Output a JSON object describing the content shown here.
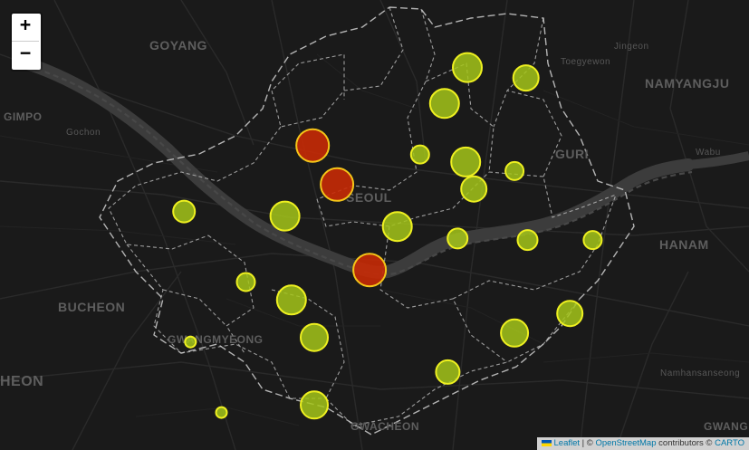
{
  "zoom_control": {
    "zoom_in": "+",
    "zoom_out": "−"
  },
  "attribution": {
    "leaflet": "Leaflet",
    "sep": " | © ",
    "osm": "OpenStreetMap",
    "contributors": " contributors © ",
    "carto": "CARTO"
  },
  "places": {
    "goyang": "GOYANG",
    "gimpo": "GIMPO",
    "gochon": "Gochon",
    "jingeon": "Jingeon",
    "toegyewon": "Toegyewon",
    "namyangju": "NAMYANGJU",
    "guri": "GURI",
    "wabu": "Wabu",
    "seoul": "SEOUL",
    "hanam": "HANAM",
    "bucheon": "BUCHEON",
    "gwangmyeong": "GWANGMYEONG",
    "heon": "HEON",
    "namhansanseong": "Namhansanseong",
    "gwacheon": "GWACHEON",
    "gwang": "GWANG"
  },
  "markers": [
    {
      "id": "m1",
      "lat": 37.655,
      "lng": 127.047,
      "level": "medium"
    },
    {
      "id": "m2",
      "lat": 37.648,
      "lng": 127.083,
      "level": "medium"
    },
    {
      "id": "m3",
      "lat": 37.631,
      "lng": 127.033,
      "level": "medium"
    },
    {
      "id": "m4",
      "lat": 37.603,
      "lng": 126.952,
      "level": "high"
    },
    {
      "id": "m5",
      "lat": 37.597,
      "lng": 127.018,
      "level": "medium"
    },
    {
      "id": "m6",
      "lat": 37.592,
      "lng": 127.046,
      "level": "medium"
    },
    {
      "id": "m7",
      "lat": 37.586,
      "lng": 127.076,
      "level": "medium"
    },
    {
      "id": "m8",
      "lat": 37.577,
      "lng": 126.967,
      "level": "high"
    },
    {
      "id": "m9",
      "lat": 37.574,
      "lng": 127.051,
      "level": "medium"
    },
    {
      "id": "m10",
      "lat": 37.559,
      "lng": 126.873,
      "level": "medium"
    },
    {
      "id": "m11",
      "lat": 37.556,
      "lng": 126.935,
      "level": "medium"
    },
    {
      "id": "m12",
      "lat": 37.549,
      "lng": 127.004,
      "level": "medium"
    },
    {
      "id": "m13",
      "lat": 37.541,
      "lng": 127.041,
      "level": "medium"
    },
    {
      "id": "m14",
      "lat": 37.54,
      "lng": 127.084,
      "level": "medium"
    },
    {
      "id": "m15",
      "lat": 37.54,
      "lng": 127.124,
      "level": "medium"
    },
    {
      "id": "m16",
      "lat": 37.52,
      "lng": 126.987,
      "level": "high"
    },
    {
      "id": "m17",
      "lat": 37.512,
      "lng": 126.911,
      "level": "medium"
    },
    {
      "id": "m18",
      "lat": 37.5,
      "lng": 126.939,
      "level": "medium"
    },
    {
      "id": "m19",
      "lat": 37.491,
      "lng": 127.11,
      "level": "medium"
    },
    {
      "id": "m20",
      "lat": 37.478,
      "lng": 127.076,
      "level": "medium"
    },
    {
      "id": "m21",
      "lat": 37.475,
      "lng": 126.953,
      "level": "medium"
    },
    {
      "id": "m22",
      "lat": 37.472,
      "lng": 126.877,
      "level": "low"
    },
    {
      "id": "m23",
      "lat": 37.452,
      "lng": 127.035,
      "level": "medium"
    },
    {
      "id": "m24",
      "lat": 37.43,
      "lng": 126.953,
      "level": "medium"
    },
    {
      "id": "m25",
      "lat": 37.425,
      "lng": 126.896,
      "level": "low"
    }
  ],
  "colors": {
    "high_fill": "#c62a06",
    "high_stroke": "#f5c518",
    "medium_fill": "#a4c51a",
    "medium_stroke": "#eef020",
    "river": "#3b3b3b",
    "road": "#2c2c2c",
    "boundary": "#bdbdbd"
  }
}
